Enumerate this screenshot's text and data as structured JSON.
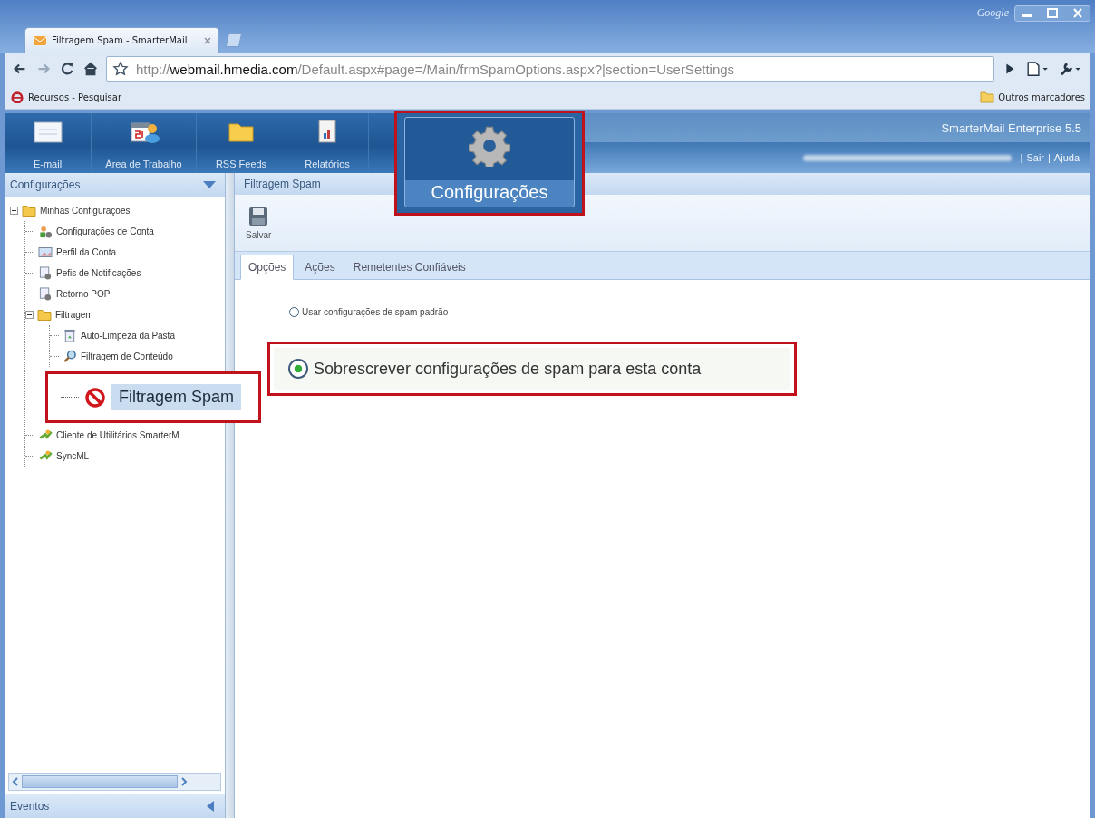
{
  "browser": {
    "logo_text": "Google",
    "tab_title": "Filtragem Spam - SmarterMail",
    "address": "http://**webmail.hmedia.com**/Default.aspx#page=/Main/frmSpamOptions.aspx?|section=UserSettings",
    "bookmarks": [
      "Recursos - Pesquisar"
    ],
    "other_bookmarks": "Outros marcadores"
  },
  "app": {
    "nav": [
      {
        "label": "E-mail",
        "kind": "mail"
      },
      {
        "label": "Área de Trabalho",
        "kind": "calendar"
      },
      {
        "label": "RSS Feeds",
        "kind": "folder"
      },
      {
        "label": "Relatórios",
        "kind": "report"
      }
    ],
    "product": "SmarterMail Enterprise 5.5",
    "separator": "|",
    "user_links": [
      "Sair",
      "Ajuda"
    ]
  },
  "sidebar": {
    "title": "Configurações",
    "footer": "Eventos",
    "tree": [
      {
        "label": "Minhas Configurações",
        "kind": "folder",
        "expanded": true,
        "children": [
          {
            "label": "Configurações de Conta",
            "kind": "user"
          },
          {
            "label": "Perfil da Conta",
            "kind": "card"
          },
          {
            "label": "Pefis de Notificações",
            "kind": "doc"
          },
          {
            "label": "Retorno POP",
            "kind": "doc"
          },
          {
            "label": "Filtragem",
            "kind": "folder",
            "expanded": true,
            "children": [
              {
                "label": "Auto-Limpeza da Pasta",
                "kind": "bin"
              },
              {
                "label": "Filtragem de Conteúdo",
                "kind": "search"
              }
            ]
          },
          {
            "label": "Cliente de Utilitários SmarterM",
            "kind": "plug"
          },
          {
            "label": "SyncML",
            "kind": "plug"
          }
        ]
      }
    ]
  },
  "content": {
    "title": "Filtragem Spam",
    "toolbar": [
      {
        "label": "Salvar"
      }
    ],
    "tabs": [
      {
        "label": "Opções",
        "selected": true
      },
      {
        "label": "Ações",
        "selected": false
      },
      {
        "label": "Remetentes Confiáveis",
        "selected": false
      }
    ],
    "options": [
      {
        "label": "Usar configurações de spam padrão",
        "checked": false
      }
    ]
  },
  "callouts": [
    {
      "kind": "nav",
      "label": "Configurações"
    },
    {
      "kind": "tree",
      "label": "Filtragem Spam",
      "selected": true
    },
    {
      "kind": "radio",
      "label": "Sobrescrever configurações de spam para esta conta",
      "checked": true
    }
  ]
}
